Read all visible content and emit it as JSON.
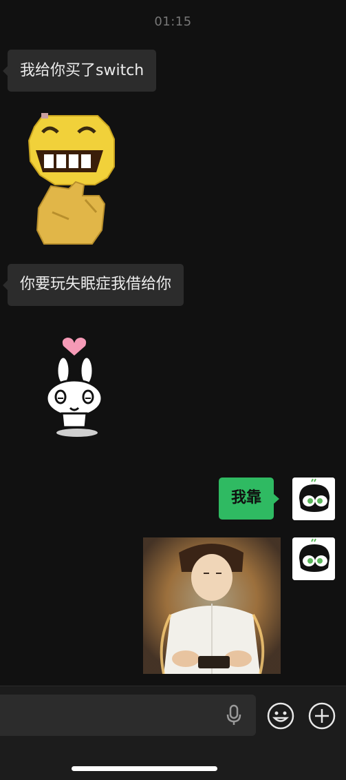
{
  "chat": {
    "timestamp": "01:15",
    "messages": [
      {
        "side": "incoming",
        "type": "text",
        "text": "我给你买了switch"
      },
      {
        "side": "incoming",
        "type": "sticker",
        "sticker": "laughing-thumb-emoji"
      },
      {
        "side": "incoming",
        "type": "text",
        "text": "你要玩失眠症我借给你"
      },
      {
        "side": "incoming",
        "type": "sticker",
        "sticker": "bunny-heart"
      },
      {
        "side": "outgoing",
        "type": "text",
        "text": "我靠"
      },
      {
        "side": "outgoing",
        "type": "image",
        "image": "glowing-person-photo"
      }
    ]
  },
  "input_bar": {
    "icons": [
      "microphone-icon",
      "emoji-icon",
      "plus-icon"
    ]
  },
  "colors": {
    "background": "#111111",
    "incoming_bubble": "#2c2c2c",
    "outgoing_bubble": "#2fba62"
  }
}
